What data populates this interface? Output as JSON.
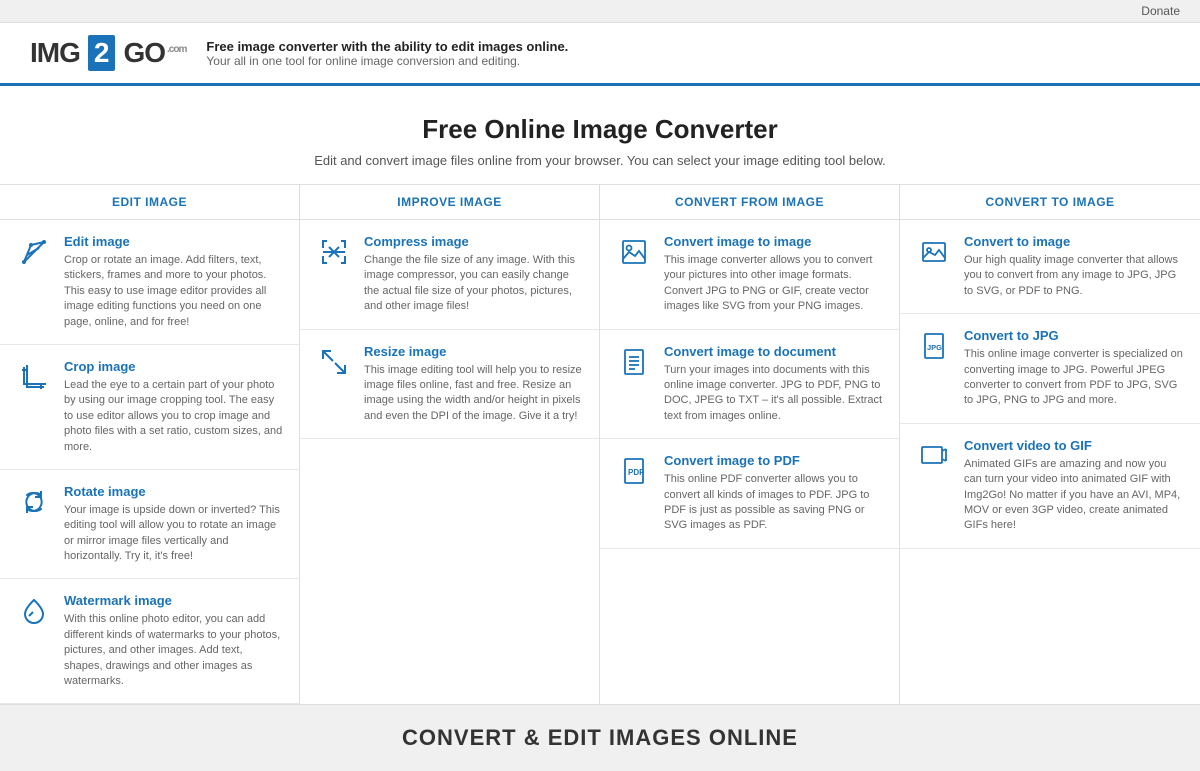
{
  "topbar": {
    "donate_label": "Donate"
  },
  "header": {
    "logo_img": "IMG",
    "logo_num": "2",
    "logo_go": "GO",
    "logo_com": ".com",
    "tagline_bold": "Free image converter with the ability to edit images online.",
    "tagline_sub": "Your all in one tool for online image conversion and editing."
  },
  "hero": {
    "title": "Free Online Image Converter",
    "subtitle": "Edit and convert image files online from your browser. You can select your image editing tool below."
  },
  "col_headers": [
    "EDIT IMAGE",
    "IMPROVE IMAGE",
    "CONVERT FROM IMAGE",
    "CONVERT TO IMAGE"
  ],
  "columns": [
    {
      "id": "edit",
      "cards": [
        {
          "icon": "edit",
          "title": "Edit image",
          "desc": "Crop or rotate an image. Add filters, text, stickers, frames and more to your photos. This easy to use image editor provides all image editing functions you need on one page, online, and for free!"
        },
        {
          "icon": "crop",
          "title": "Crop image",
          "desc": "Lead the eye to a certain part of your photo by using our image cropping tool. The easy to use editor allows you to crop image and photo files with a set ratio, custom sizes, and more."
        },
        {
          "icon": "rotate",
          "title": "Rotate image",
          "desc": "Your image is upside down or inverted? This editing tool will allow you to rotate an image or mirror image files vertically and horizontally. Try it, it's free!"
        },
        {
          "icon": "watermark",
          "title": "Watermark image",
          "desc": "With this online photo editor, you can add different kinds of watermarks to your photos, pictures, and other images. Add text, shapes, drawings and other images as watermarks."
        }
      ]
    },
    {
      "id": "improve",
      "cards": [
        {
          "icon": "compress",
          "title": "Compress image",
          "desc": "Change the file size of any image. With this image compressor, you can easily change the actual file size of your photos, pictures, and other image files!"
        },
        {
          "icon": "resize",
          "title": "Resize image",
          "desc": "This image editing tool will help you to resize image files online, fast and free. Resize an image using the width and/or height in pixels and even the DPI of the image. Give it a try!"
        }
      ]
    },
    {
      "id": "convert-from",
      "cards": [
        {
          "icon": "convert-image",
          "title": "Convert image to image",
          "desc": "This image converter allows you to convert your pictures into other image formats. Convert JPG to PNG or GIF, create vector images like SVG from your PNG images."
        },
        {
          "icon": "convert-doc",
          "title": "Convert image to document",
          "desc": "Turn your images into documents with this online image converter. JPG to PDF, PNG to DOC, JPEG to TXT – it's all possible. Extract text from images online."
        },
        {
          "icon": "convert-pdf",
          "title": "Convert image to PDF",
          "desc": "This online PDF converter allows you to convert all kinds of images to PDF. JPG to PDF is just as possible as saving PNG or SVG images as PDF."
        }
      ]
    },
    {
      "id": "convert-to",
      "cards": [
        {
          "icon": "to-image",
          "title": "Convert to image",
          "desc": "Our high quality image converter that allows you to convert from any image to JPG, JPG to SVG, or PDF to PNG."
        },
        {
          "icon": "to-jpg",
          "title": "Convert to JPG",
          "desc": "This online image converter is specialized on converting image to JPG. Powerful JPEG converter to convert from PDF to JPG, SVG to JPG, PNG to JPG and more."
        },
        {
          "icon": "video-gif",
          "title": "Convert video to GIF",
          "desc": "Animated GIFs are amazing and now you can turn your video into animated GIF with Img2Go! No matter if you have an AVI, MP4, MOV or even 3GP video, create animated GIFs here!"
        }
      ]
    }
  ],
  "bottom": {
    "title": "CONVERT & EDIT IMAGES ONLINE"
  }
}
